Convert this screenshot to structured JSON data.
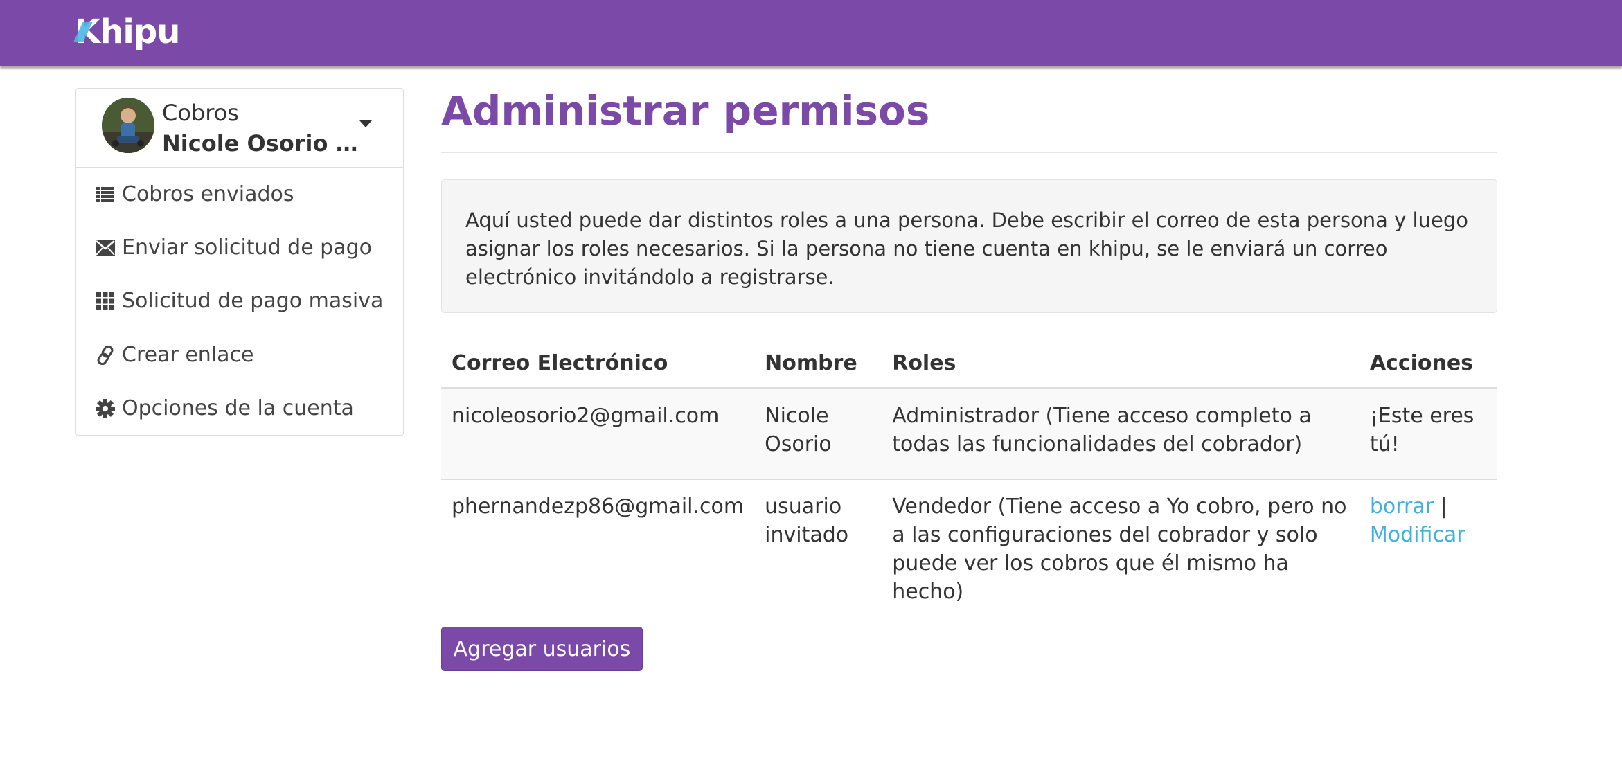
{
  "header": {
    "brand_k": "K",
    "brand_rest": "hipu",
    "accent_color": "#7b4aa8",
    "logo_accent_color": "#4fb6e6"
  },
  "sidebar": {
    "account_label": "Cobros",
    "account_name": "Nicole Osorio …",
    "groups": [
      [
        {
          "label": "Cobros enviados",
          "icon": "list-icon"
        },
        {
          "label": "Enviar solicitud de pago",
          "icon": "envelope-icon"
        },
        {
          "label": "Solicitud de pago masiva",
          "icon": "grid-icon"
        }
      ],
      [
        {
          "label": "Crear enlace",
          "icon": "link-icon"
        },
        {
          "label": "Opciones de la cuenta",
          "icon": "gear-icon"
        }
      ]
    ]
  },
  "main": {
    "title": "Administrar permisos",
    "info_text": "Aquí usted puede dar distintos roles a una persona. Debe escribir el correo de esta persona y luego asignar los roles necesarios. Si la persona no tiene cuenta en khipu, se le enviará un correo electrónico invitándolo a registrarse.",
    "table": {
      "headers": [
        "Correo Electrónico",
        "Nombre",
        "Roles",
        "Acciones"
      ],
      "rows": [
        {
          "email": "nicoleosorio2@gmail.com",
          "name": "Nicole Osorio",
          "role": "Administrador (Tiene acceso completo a todas las funcionalidades del cobrador)",
          "action_text": "¡Este eres tú!"
        },
        {
          "email": "phernandezp86@gmail.com",
          "name": "usuario invitado",
          "role": "Vendedor (Tiene acceso a Yo cobro, pero no a las configuraciones del cobrador y solo puede ver los cobros que él mismo ha hecho)",
          "delete_label": "borrar",
          "separator": "|",
          "modify_label": "Modificar"
        }
      ]
    },
    "add_button_label": "Agregar usuarios"
  }
}
